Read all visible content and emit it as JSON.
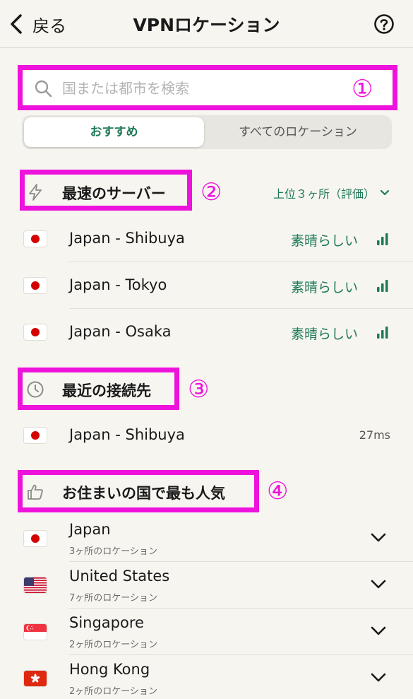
{
  "header": {
    "back_label": "戻る",
    "title": "VPNロケーション"
  },
  "search": {
    "placeholder": "国または都市を検索"
  },
  "segment": {
    "recommended": "おすすめ",
    "all": "すべてのロケーション",
    "selected": "おすすめ"
  },
  "annotations": [
    "①",
    "②",
    "③",
    "④"
  ],
  "annotation_color": "#ee13dc",
  "accent_color": "#1f7a57",
  "fastest": {
    "title": "最速のサーバー",
    "icon": "lightning-icon",
    "sort_label": "上位３ヶ所（評価）",
    "items": [
      {
        "name": "Japan - Shibuya",
        "quality": "素晴らしい",
        "signal_bars": 3
      },
      {
        "name": "Japan - Tokyo",
        "quality": "素晴らしい",
        "signal_bars": 3
      },
      {
        "name": "Japan - Osaka",
        "quality": "素晴らしい",
        "signal_bars": 3
      }
    ]
  },
  "recent": {
    "title": "最近の接続先",
    "icon": "clock-icon",
    "items": [
      {
        "name": "Japan - Shibuya",
        "ping": "27ms"
      }
    ]
  },
  "popular": {
    "title": "お住まいの国で最も人気",
    "icon": "thumbs-up-icon",
    "items": [
      {
        "name": "Japan",
        "sub": "3ヶ所のロケーション",
        "flag": "japan-flag"
      },
      {
        "name": "United States",
        "sub": "7ヶ所のロケーション",
        "flag": "us-flag"
      },
      {
        "name": "Singapore",
        "sub": "2ヶ所のロケーション",
        "flag": "singapore-flag"
      },
      {
        "name": "Hong Kong",
        "sub": "2ヶ所のロケーション",
        "flag": "hong-kong-flag"
      }
    ]
  }
}
